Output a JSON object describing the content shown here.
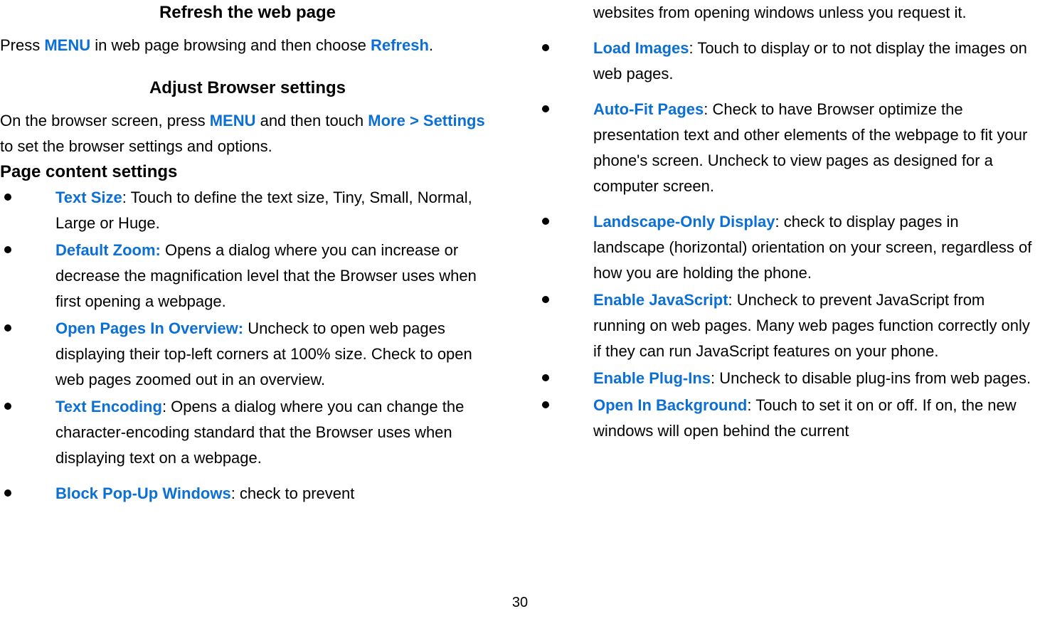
{
  "left": {
    "heading1": "Refresh the web page",
    "p1_a": "Press ",
    "p1_hl1": "MENU",
    "p1_b": " in web page browsing and then choose ",
    "p1_hl2": "Refresh",
    "p1_c": ".",
    "heading2": "Adjust Browser settings",
    "p2_a": "On the browser screen, press ",
    "p2_hl1": "MENU",
    "p2_b": " and then touch ",
    "p2_hl2": "More > Settings",
    "p2_c": " to set the browser settings and options.",
    "subhead": "Page content settings",
    "items": [
      {
        "label": "Text Size",
        "sep": ": ",
        "desc": "Touch to define the text size, Tiny, Small, Normal, Large or Huge."
      },
      {
        "label": "Default Zoom:",
        "sep": " ",
        "desc": "Opens a dialog where you can increase or decrease the magnification level that the Browser uses when first opening a webpage."
      },
      {
        "label": "Open Pages In Overview:",
        "sep": " ",
        "desc": "Uncheck to open web pages displaying their top-left corners at 100% size. Check to open web pages zoomed out in an overview."
      },
      {
        "label": "Text Encoding",
        "sep": ": ",
        "desc": "Opens a dialog where you can change the character-encoding standard that the Browser uses when displaying text on a webpage."
      },
      {
        "label": "Block Pop-Up Windows",
        "sep": ": ",
        "desc": "check to prevent"
      }
    ]
  },
  "right": {
    "continuation": "websites from opening windows unless you request it.",
    "items": [
      {
        "label": "Load Images",
        "sep": ": ",
        "desc": "Touch to display or to not display the images on web pages."
      },
      {
        "label": "Auto-Fit Pages",
        "sep": ": ",
        "desc": "Check to have Browser optimize the presentation text and other elements of the webpage to fit your phone's screen. Uncheck to view pages as designed for a computer screen."
      },
      {
        "label": "Landscape-Only Display",
        "sep": ": ",
        "desc": "check to display pages in landscape (horizontal) orientation on your screen, regardless of how you are holding the phone."
      },
      {
        "label": "Enable JavaScript",
        "sep": ": ",
        "desc": "Uncheck to prevent JavaScript from running on web pages. Many web pages function correctly only if they can run JavaScript features on your phone."
      },
      {
        "label": "Enable Plug-Ins",
        "sep": ": ",
        "desc": "Uncheck to disable plug-ins from web pages."
      },
      {
        "label": "Open In Background",
        "sep": ": ",
        "desc": "Touch to set it on or off. If on, the new windows will open behind the current"
      }
    ]
  },
  "page_number": "30"
}
